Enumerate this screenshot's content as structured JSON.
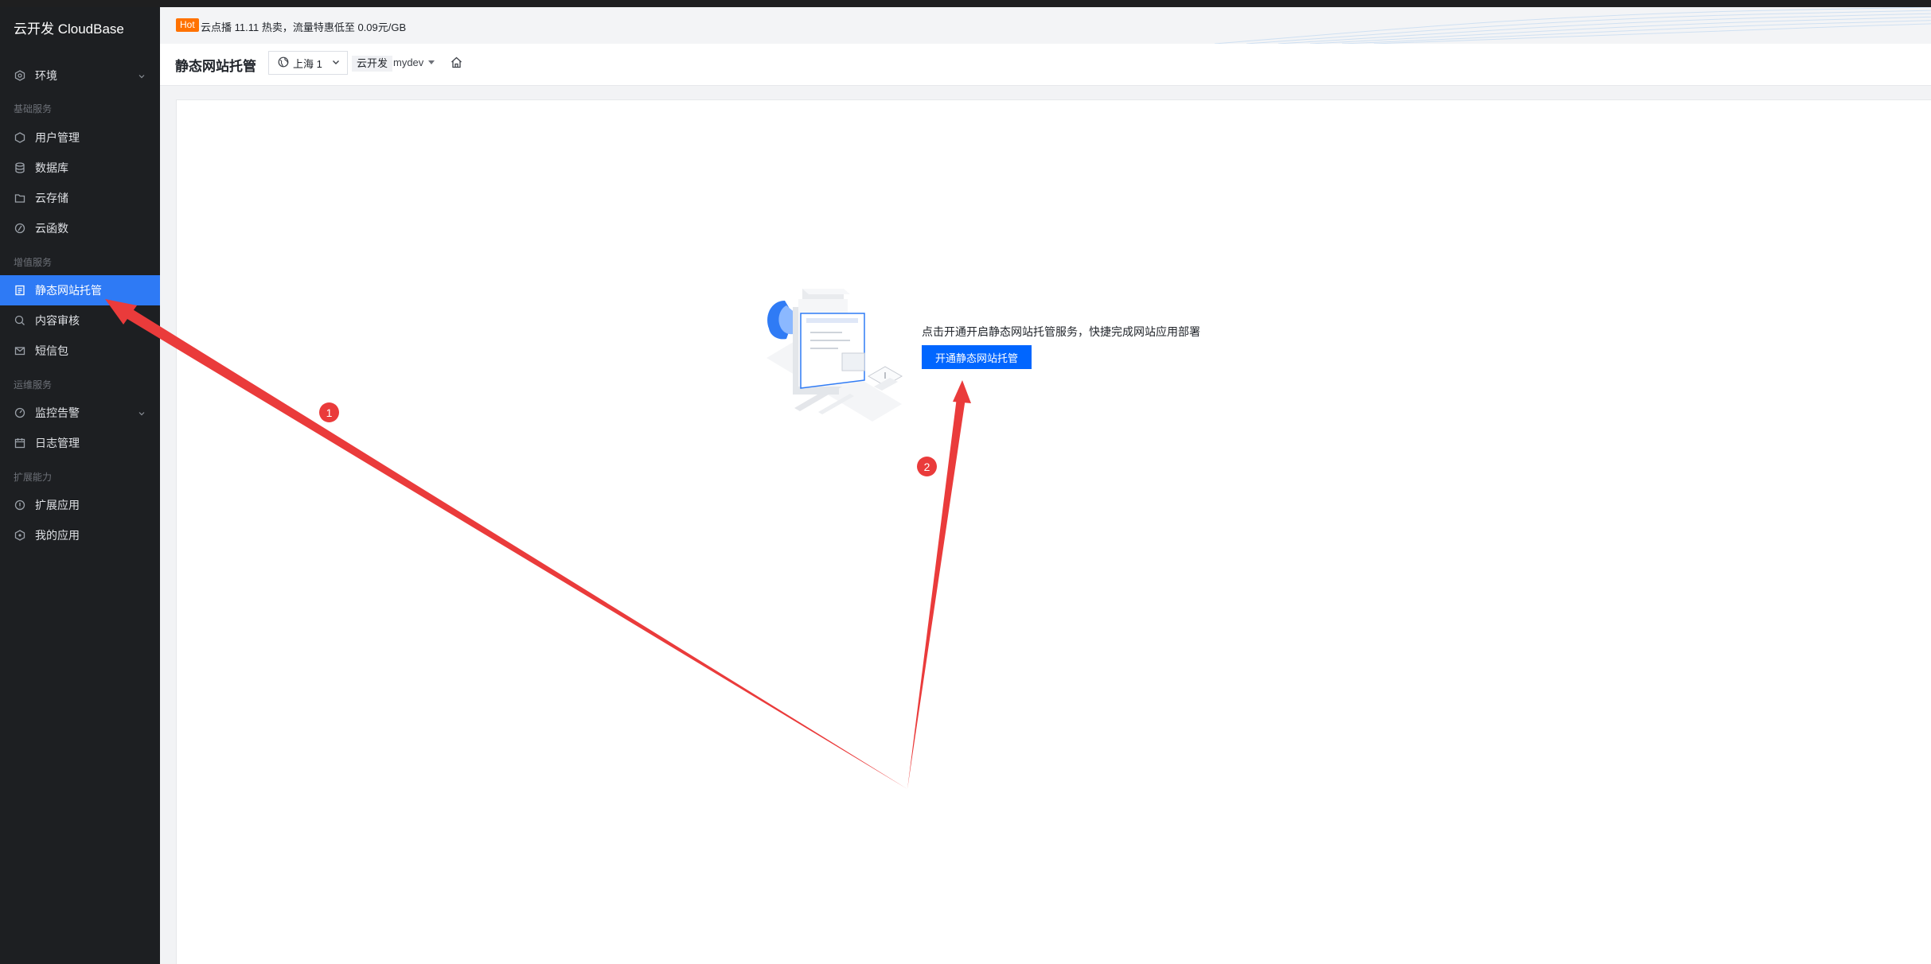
{
  "app": {
    "brand": "云开发 CloudBase"
  },
  "sidebar": {
    "env_item": {
      "label": "环境",
      "icon": "environment-icon"
    },
    "groups": {
      "basic": "基础服务",
      "value_added": "增值服务",
      "ops": "运维服务",
      "extension": "扩展能力"
    },
    "items": [
      {
        "label": "用户管理",
        "icon": "user-icon"
      },
      {
        "label": "数据库",
        "icon": "database-icon"
      },
      {
        "label": "云存储",
        "icon": "folder-icon"
      },
      {
        "label": "云函数",
        "icon": "function-icon"
      },
      {
        "label": "静态网站托管",
        "icon": "document-icon",
        "active": true
      },
      {
        "label": "内容审核",
        "icon": "search-icon"
      },
      {
        "label": "短信包",
        "icon": "mail-icon"
      },
      {
        "label": "监控告警",
        "icon": "monitor-icon"
      },
      {
        "label": "日志管理",
        "icon": "calendar-icon"
      },
      {
        "label": "扩展应用",
        "icon": "extension-icon"
      },
      {
        "label": "我的应用",
        "icon": "app-icon"
      }
    ]
  },
  "announcement": {
    "badge": "Hot",
    "text": "云点播 11.11 热卖，流量特惠低至 0.09元/GB"
  },
  "header": {
    "title": "静态网站托管",
    "region": "上海 1",
    "env_label": "云开发",
    "env_value": "mydev"
  },
  "main": {
    "empty_state": {
      "description": "点击开通开启静态网站托管服务，快捷完成网站应用部署",
      "button_label": "开通静态网站托管"
    }
  },
  "annotations": {
    "marker_1": "1",
    "marker_2": "2"
  },
  "colors": {
    "sidebar_bg": "#1d1f22",
    "active": "#2e7af5",
    "primary_button": "#0066ff",
    "hot": "#ff7200",
    "annotation": "#ea3b3b"
  }
}
